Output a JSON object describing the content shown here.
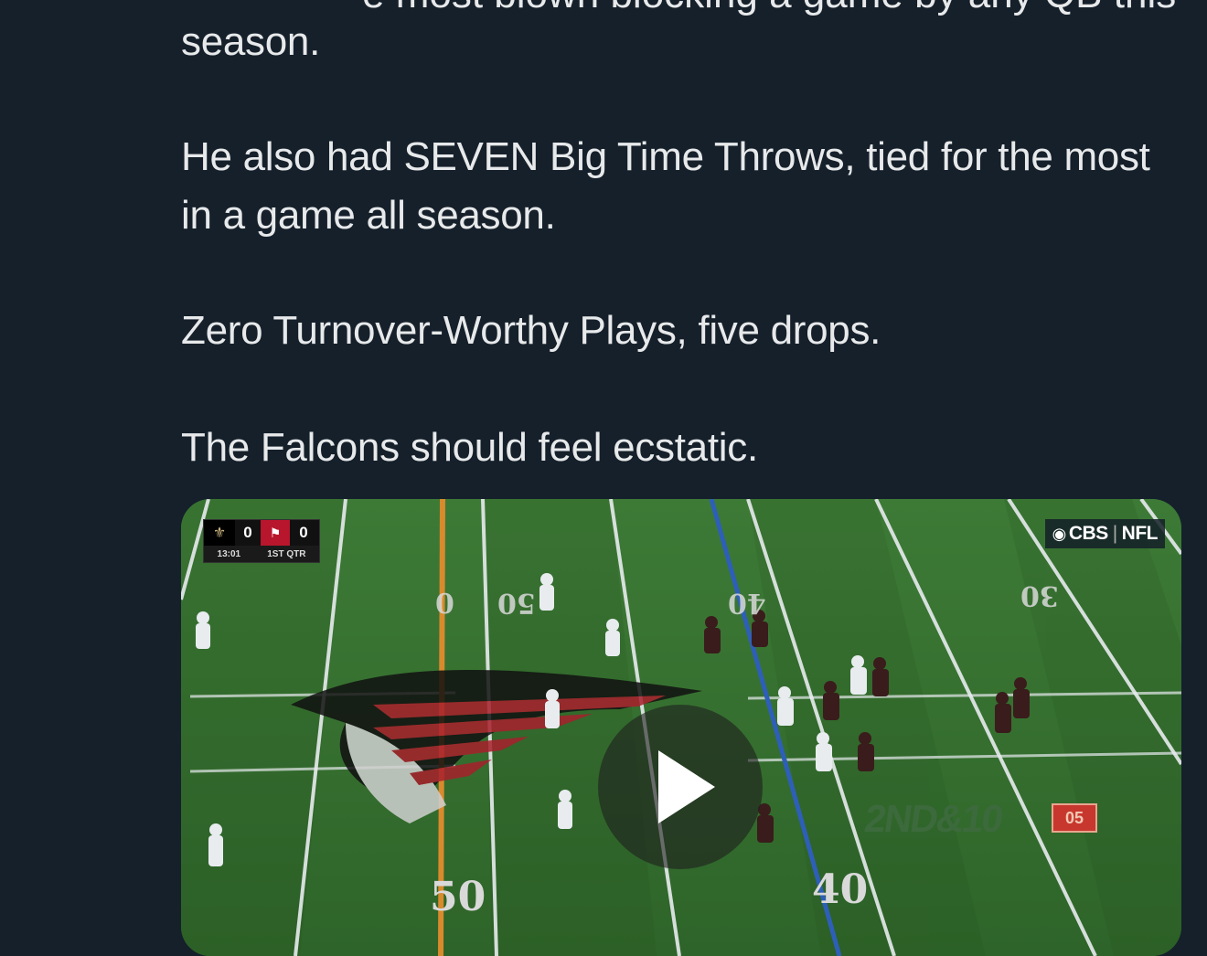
{
  "tweet": {
    "cut_line": "e most blown blocking a game by any QB this",
    "p1": "season.",
    "p2": "He also had SEVEN Big Time Throws, tied for the most in a game all season.",
    "p3": "Zero Turnover-Worthy Plays, five drops.",
    "p4": "The Falcons should feel ecstatic."
  },
  "video": {
    "scorebug": {
      "team1_score": "0",
      "team2_score": "0",
      "clock": "13:01",
      "quarter": "1ST QTR"
    },
    "network": {
      "left": "CBS",
      "right": "NFL"
    },
    "down_distance": "2ND&10",
    "playclock": "05",
    "yard_numbers": [
      "50",
      "40",
      "0",
      "50",
      "40",
      "30"
    ]
  }
}
